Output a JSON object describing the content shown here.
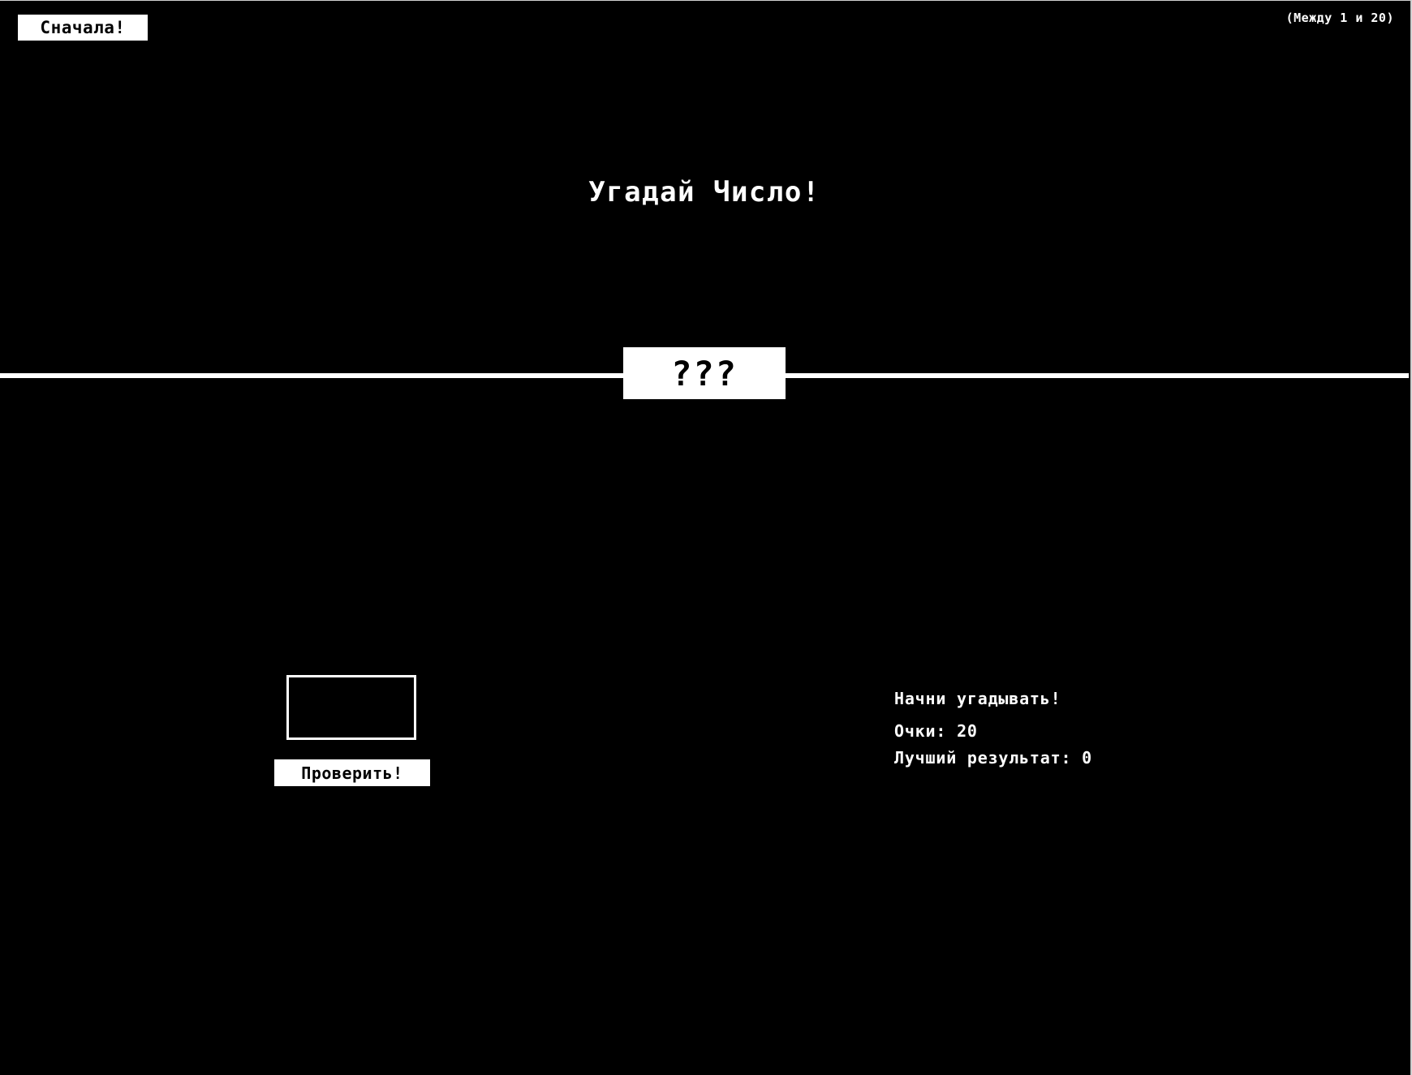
{
  "header": {
    "again_label": "Сначала!",
    "range_hint": "(Между 1 и 20)"
  },
  "title": "Угадай Число!",
  "secret": "???",
  "guess": {
    "value": "",
    "check_label": "Проверить!"
  },
  "status": {
    "message": "Начни угадывать!",
    "score_label": "Очки:",
    "score_value": "20",
    "highscore_label": "Лучший результат:",
    "highscore_value": "0"
  },
  "colors": {
    "background": "#000000",
    "foreground": "#ffffff"
  }
}
